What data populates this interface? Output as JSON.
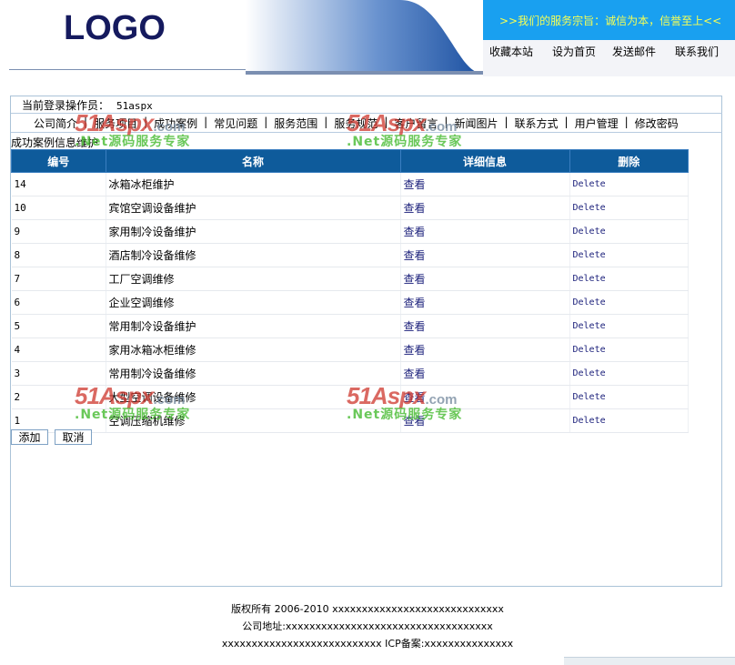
{
  "header": {
    "logo": "LOGO",
    "motto": ">>我们的服务宗旨：诚信为本，信誉至上<<",
    "links": [
      "收藏本站",
      "设为首页",
      "发送邮件",
      "联系我们"
    ]
  },
  "operator": {
    "label": "当前登录操作员：",
    "value": "51aspx"
  },
  "nav": [
    "公司简介",
    "服务项目",
    "成功案例",
    "常见问题",
    "服务范围",
    "服务规范",
    "客户留言",
    "新闻图片",
    "联系方式",
    "用户管理",
    "修改密码"
  ],
  "page_title": "成功案例信息维护",
  "table": {
    "columns": [
      "编号",
      "名称",
      "详细信息",
      "删除"
    ],
    "rows": [
      {
        "id": "14",
        "name": "冰箱冰柜维护",
        "view": "查看",
        "del": "Delete"
      },
      {
        "id": "10",
        "name": "宾馆空调设备维护",
        "view": "查看",
        "del": "Delete"
      },
      {
        "id": "9",
        "name": "家用制冷设备维护",
        "view": "查看",
        "del": "Delete"
      },
      {
        "id": "8",
        "name": "酒店制冷设备维修",
        "view": "查看",
        "del": "Delete"
      },
      {
        "id": "7",
        "name": "工厂空调维修",
        "view": "查看",
        "del": "Delete"
      },
      {
        "id": "6",
        "name": "企业空调维修",
        "view": "查看",
        "del": "Delete"
      },
      {
        "id": "5",
        "name": "常用制冷设备维护",
        "view": "查看",
        "del": "Delete"
      },
      {
        "id": "4",
        "name": "家用冰箱冰柜维修",
        "view": "查看",
        "del": "Delete"
      },
      {
        "id": "3",
        "name": "常用制冷设备维修",
        "view": "查看",
        "del": "Delete"
      },
      {
        "id": "2",
        "name": "大型空调设备维修",
        "view": "查看",
        "del": "Delete"
      },
      {
        "id": "1",
        "name": "空调压缩机维修",
        "view": "查看",
        "del": "Delete"
      }
    ]
  },
  "buttons": {
    "add": "添加",
    "cancel": "取消"
  },
  "footer": {
    "line1": "版权所有 2006-2010 xxxxxxxxxxxxxxxxxxxxxxxxxxxxx",
    "line2": "公司地址:xxxxxxxxxxxxxxxxxxxxxxxxxxxxxxxxxxx",
    "line3": "xxxxxxxxxxxxxxxxxxxxxxxxxxx ICP备案:xxxxxxxxxxxxxxx"
  },
  "watermark": {
    "brand": "51Aspx",
    "domain": ".com",
    "tagline": ".Net源码服务专家"
  },
  "colors": {
    "table_header": "#0e5b9b",
    "motto_bar": "#19a0f0",
    "motto_text": "#f6ff55",
    "logo": "#151a5e",
    "watermark_red": "#cd372d",
    "watermark_green": "#50be3c"
  }
}
